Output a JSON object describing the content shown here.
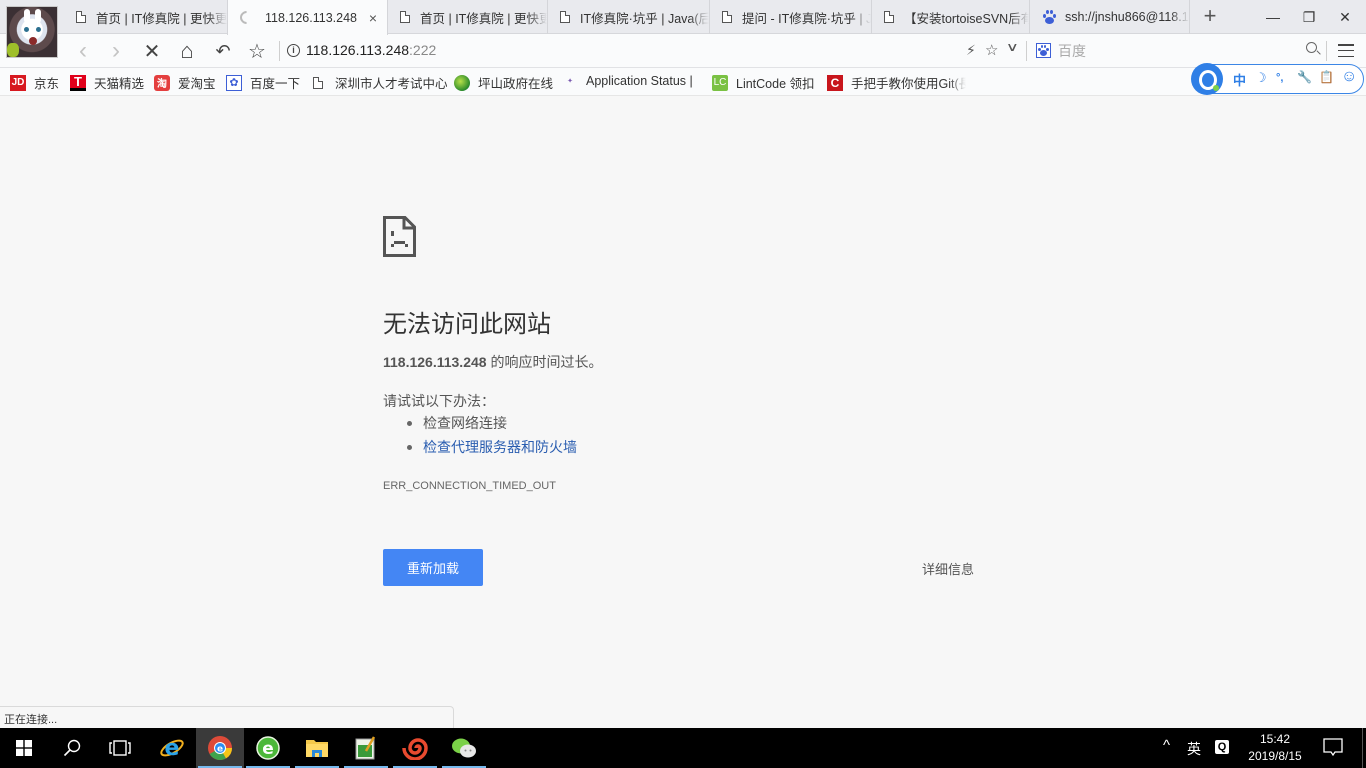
{
  "browser": {
    "tabs": [
      {
        "title": "首页 | IT修真院 | 更快更",
        "icon": "page-icon",
        "active": false
      },
      {
        "title": "118.126.113.248",
        "icon": "loading-spinner-icon",
        "active": true,
        "close": "×"
      },
      {
        "title": "首页 | IT修真院 | 更快更",
        "icon": "page-icon",
        "active": false
      },
      {
        "title": "IT修真院·坑乎 | Java(后",
        "icon": "page-icon",
        "active": false
      },
      {
        "title": "提问 - IT修真院·坑乎 | J",
        "icon": "page-icon",
        "active": false
      },
      {
        "title": "【安装tortoiseSVN后有",
        "icon": "page-icon",
        "active": false
      },
      {
        "title": "ssh://jnshu866@118.1",
        "icon": "baidu-paw-icon",
        "active": false
      }
    ],
    "new_tab": "+",
    "window_controls": {
      "minimize": "—",
      "restore": "❐",
      "close": "✕"
    },
    "toolbar": {
      "back": "‹",
      "forward": "›",
      "stop": "✕",
      "home": "⌂",
      "undo": "↶",
      "favorite": "☆",
      "url_host": "118.126.113.248",
      "url_port": ":222",
      "bolt": "⚡",
      "star": "☆",
      "dropdown": "∨",
      "search_placeholder": "百度"
    },
    "bookmarks": [
      {
        "label": "京东",
        "icon": "jd-icon",
        "icon_text": "JD",
        "color": "#d71920"
      },
      {
        "label": "天猫精选",
        "icon": "tmall-icon",
        "icon_text": "T",
        "color": "#e0001b"
      },
      {
        "label": "爱淘宝",
        "icon": "taobao-icon",
        "icon_text": "淘",
        "color": "#e43f3f"
      },
      {
        "label": "百度一下",
        "icon": "baidu-icon",
        "icon_text": "",
        "color": "#3d5fd6"
      },
      {
        "label": "深圳市人才考试中心",
        "icon": "page-icon",
        "icon_text": "",
        "color": ""
      },
      {
        "label": "坪山政府在线",
        "icon": "globe-icon",
        "icon_text": "",
        "color": "#2a8a2a"
      },
      {
        "label": "Application Status |",
        "icon": "app-status-icon",
        "icon_text": "",
        "color": "#7a5ab0"
      },
      {
        "label": "LintCode 领扣",
        "icon": "lintcode-icon",
        "icon_text": "LC",
        "color": "#7ac143"
      },
      {
        "label": "手把手教你使用Git(長",
        "icon": "git-c-icon",
        "icon_text": "C",
        "color": "#c8161d"
      }
    ],
    "ime_bar": {
      "items": [
        "中",
        "☽",
        "°,",
        "🔧",
        "📋",
        "☺"
      ]
    },
    "status_text": "正在连接..."
  },
  "error_page": {
    "title": "无法访问此网站",
    "host": "118.126.113.248",
    "description_suffix": " 的响应时间过长。",
    "suggest_label": "请试试以下办法：",
    "suggestions": [
      {
        "text": "检查网络连接",
        "link": false
      },
      {
        "text": "检查代理服务器和防火墙",
        "link": true
      }
    ],
    "error_code": "ERR_CONNECTION_TIMED_OUT",
    "reload_label": "重新加载",
    "details_label": "详细信息",
    "accent_color": "#4486f4"
  },
  "taskbar": {
    "items": [
      {
        "name": "start-button",
        "icon": "windows-icon"
      },
      {
        "name": "search-button",
        "icon": "search-icon"
      },
      {
        "name": "task-view-button",
        "icon": "task-view-icon"
      },
      {
        "name": "ie-button",
        "icon": "internet-explorer-icon"
      },
      {
        "name": "browser-button",
        "icon": "browser-icon"
      },
      {
        "name": "green-browser-button",
        "icon": "green-e-icon"
      },
      {
        "name": "file-explorer-button",
        "icon": "folder-icon"
      },
      {
        "name": "notepad-button",
        "icon": "notepad-icon"
      },
      {
        "name": "snail-app-button",
        "icon": "snail-icon"
      },
      {
        "name": "wechat-button",
        "icon": "wechat-icon"
      }
    ],
    "tray": {
      "chevron": "^",
      "ime_lang": "英",
      "ime_icon": "Q",
      "time": "15:42",
      "date": "2019/8/15"
    }
  }
}
